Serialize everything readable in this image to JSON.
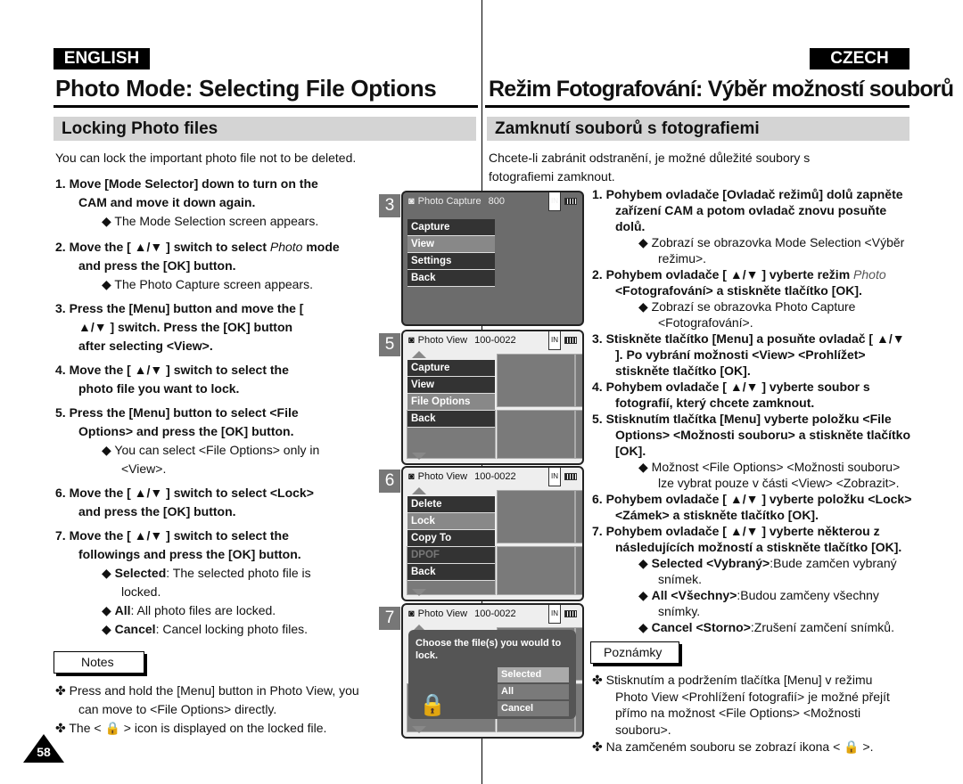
{
  "english": {
    "lang_badge": "ENGLISH",
    "title": "Photo Mode: Selecting File Options",
    "section": "Locking Photo files",
    "intro": "You can lock the important photo file not to be deleted.",
    "steps": [
      {
        "text": "1. Move [Mode Selector] down to turn on the CAM and move it down again.",
        "bullets": [
          "The Mode Selection screen appears."
        ]
      },
      {
        "text_a": "2. Move the [ ▲/▼ ] switch to select ",
        "text_italic": "Photo",
        "text_b": " mode and press the [OK] button.",
        "bullets": [
          "The Photo Capture screen appears."
        ]
      },
      {
        "text": "3. Press the [Menu] button and move the [ ▲/▼ ] switch. Press the [OK] button after selecting <View>."
      },
      {
        "text": "4. Move the [ ▲/▼ ] switch to select the photo file you want to lock."
      },
      {
        "text": "5. Press the [Menu] button to select <File Options> and press the [OK] button.",
        "bullets": [
          "You can select <File Options> only in <View>."
        ]
      },
      {
        "text": "6. Move the [ ▲/▼ ] switch to select <Lock> and press the [OK] button."
      },
      {
        "text": "7. Move the [ ▲/▼ ] switch to select the followings and press the [OK] button.",
        "options": [
          {
            "label": "Selected",
            "desc": ": The selected photo file is locked."
          },
          {
            "label": "All",
            "desc": ": All photo files are locked."
          },
          {
            "label": "Cancel",
            "desc": ": Cancel locking photo files."
          }
        ]
      }
    ],
    "notes_label": "Notes",
    "notes": [
      "Press and hold the [Menu] button in Photo View, you can move to <File Options> directly.",
      {
        "before": "The < ",
        "after": " > icon is displayed on the locked file."
      }
    ],
    "page_number": "58"
  },
  "czech": {
    "lang_badge": "CZECH",
    "title": "Režim Fotografování: Výběr možností souborů",
    "section": "Zamknutí souborů s fotografiemi",
    "intro": "Chcete-li zabránit odstranění, je možné důležité soubory s fotografiemi zamknout.",
    "steps": [
      {
        "text": "1. Pohybem ovladače [Ovladač režimů] dolů zapněte zařízení CAM a potom ovladač znovu posuňte dolů.",
        "bullets": [
          "Zobrazí se obrazovka Mode Selection <Výběr režimu>."
        ]
      },
      {
        "text_a": "2. Pohybem ovladače [ ▲/▼ ] vyberte režim ",
        "text_italic": "Photo",
        "text_b": " <Fotografování> a stiskněte tlačítko [OK].",
        "bullets": [
          "Zobrazí se obrazovka Photo Capture <Fotografování>."
        ]
      },
      {
        "text": "3. Stiskněte tlačítko [Menu] a posuňte ovladač [ ▲/▼ ]. Po vybrání možnosti <View> <Prohlížet> stiskněte tlačítko [OK]."
      },
      {
        "text": "4. Pohybem ovladače [ ▲/▼ ] vyberte soubor s fotografií, který chcete zamknout."
      },
      {
        "text": "5. Stisknutím tlačítka [Menu] vyberte položku <File Options> <Možnosti souboru> a stiskněte tlačítko [OK].",
        "bullets": [
          "Možnost <File Options> <Možnosti souboru> lze vybrat pouze v části <View> <Zobrazit>."
        ]
      },
      {
        "text": "6. Pohybem ovladače [ ▲/▼ ] vyberte položku <Lock> <Zámek> a stiskněte tlačítko [OK]."
      },
      {
        "text": "7. Pohybem ovladače [ ▲/▼ ] vyberte některou z následujících možností a stiskněte tlačítko [OK].",
        "options": [
          {
            "label": "Selected <Vybraný>",
            "desc": ":Bude zamčen vybraný snímek."
          },
          {
            "label": "All <Všechny>",
            "desc": ":Budou zamčeny všechny snímky."
          },
          {
            "label": "Cancel <Storno>",
            "desc": ":Zrušení zamčení snímků."
          }
        ]
      }
    ],
    "notes_label": "Poznámky",
    "notes": [
      "Stisknutím a podržením tlačítka [Menu] v režimu Photo View <Prohlížení fotografií> je možné přejít přímo na možnost <File Options> <Možnosti souboru>.",
      {
        "before": "Na zamčeném souboru se zobrazí ikona < ",
        "after": " >."
      }
    ]
  },
  "screens": [
    {
      "step": "3",
      "header": "Photo Capture",
      "counter": "800",
      "menu": [
        "Capture",
        "View",
        "Settings",
        "Back"
      ],
      "selected": "View"
    },
    {
      "step": "5",
      "header": "Photo View",
      "counter": "100-0022",
      "menu": [
        "Capture",
        "View",
        "File Options",
        "Back"
      ],
      "selected": "File Options"
    },
    {
      "step": "6",
      "header": "Photo View",
      "counter": "100-0022",
      "menu": [
        "Delete",
        "Lock",
        "Copy To",
        "DPOF",
        "Back"
      ],
      "selected": "Lock",
      "disabled": "DPOF"
    },
    {
      "step": "7",
      "header": "Photo View",
      "counter": "100-0022",
      "dialog": "Choose the file(s) you would to lock.",
      "options": [
        "Selected",
        "All",
        "Cancel"
      ],
      "selected": "Selected"
    }
  ],
  "icons": {
    "camera": "camera-icon",
    "memory": "internal-memory-icon",
    "battery": "battery-icon",
    "lock": "lock-icon",
    "bullet": "diamond-bullet-icon",
    "note": "clover-bullet-icon"
  },
  "colors": {
    "badge": "#000000",
    "section_bar": "#d4d4d4",
    "menu_bg": "#333333",
    "menu_selected": "#888888"
  }
}
